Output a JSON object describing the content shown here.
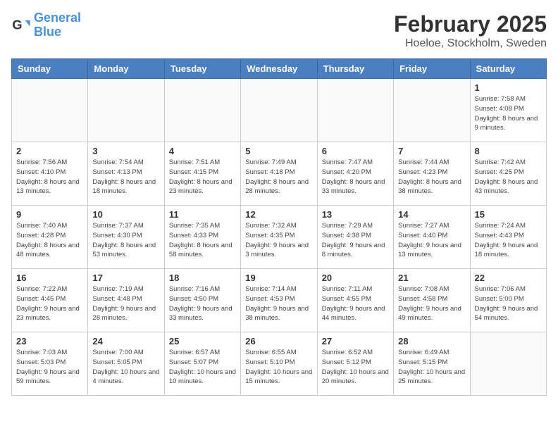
{
  "logo": {
    "line1": "General",
    "line2": "Blue"
  },
  "title": "February 2025",
  "subtitle": "Hoeloe, Stockholm, Sweden",
  "weekdays": [
    "Sunday",
    "Monday",
    "Tuesday",
    "Wednesday",
    "Thursday",
    "Friday",
    "Saturday"
  ],
  "weeks": [
    [
      {
        "day": "",
        "info": ""
      },
      {
        "day": "",
        "info": ""
      },
      {
        "day": "",
        "info": ""
      },
      {
        "day": "",
        "info": ""
      },
      {
        "day": "",
        "info": ""
      },
      {
        "day": "",
        "info": ""
      },
      {
        "day": "1",
        "info": "Sunrise: 7:58 AM\nSunset: 4:08 PM\nDaylight: 8 hours and 9 minutes."
      }
    ],
    [
      {
        "day": "2",
        "info": "Sunrise: 7:56 AM\nSunset: 4:10 PM\nDaylight: 8 hours and 13 minutes."
      },
      {
        "day": "3",
        "info": "Sunrise: 7:54 AM\nSunset: 4:13 PM\nDaylight: 8 hours and 18 minutes."
      },
      {
        "day": "4",
        "info": "Sunrise: 7:51 AM\nSunset: 4:15 PM\nDaylight: 8 hours and 23 minutes."
      },
      {
        "day": "5",
        "info": "Sunrise: 7:49 AM\nSunset: 4:18 PM\nDaylight: 8 hours and 28 minutes."
      },
      {
        "day": "6",
        "info": "Sunrise: 7:47 AM\nSunset: 4:20 PM\nDaylight: 8 hours and 33 minutes."
      },
      {
        "day": "7",
        "info": "Sunrise: 7:44 AM\nSunset: 4:23 PM\nDaylight: 8 hours and 38 minutes."
      },
      {
        "day": "8",
        "info": "Sunrise: 7:42 AM\nSunset: 4:25 PM\nDaylight: 8 hours and 43 minutes."
      }
    ],
    [
      {
        "day": "9",
        "info": "Sunrise: 7:40 AM\nSunset: 4:28 PM\nDaylight: 8 hours and 48 minutes."
      },
      {
        "day": "10",
        "info": "Sunrise: 7:37 AM\nSunset: 4:30 PM\nDaylight: 8 hours and 53 minutes."
      },
      {
        "day": "11",
        "info": "Sunrise: 7:35 AM\nSunset: 4:33 PM\nDaylight: 8 hours and 58 minutes."
      },
      {
        "day": "12",
        "info": "Sunrise: 7:32 AM\nSunset: 4:35 PM\nDaylight: 9 hours and 3 minutes."
      },
      {
        "day": "13",
        "info": "Sunrise: 7:29 AM\nSunset: 4:38 PM\nDaylight: 9 hours and 8 minutes."
      },
      {
        "day": "14",
        "info": "Sunrise: 7:27 AM\nSunset: 4:40 PM\nDaylight: 9 hours and 13 minutes."
      },
      {
        "day": "15",
        "info": "Sunrise: 7:24 AM\nSunset: 4:43 PM\nDaylight: 9 hours and 18 minutes."
      }
    ],
    [
      {
        "day": "16",
        "info": "Sunrise: 7:22 AM\nSunset: 4:45 PM\nDaylight: 9 hours and 23 minutes."
      },
      {
        "day": "17",
        "info": "Sunrise: 7:19 AM\nSunset: 4:48 PM\nDaylight: 9 hours and 28 minutes."
      },
      {
        "day": "18",
        "info": "Sunrise: 7:16 AM\nSunset: 4:50 PM\nDaylight: 9 hours and 33 minutes."
      },
      {
        "day": "19",
        "info": "Sunrise: 7:14 AM\nSunset: 4:53 PM\nDaylight: 9 hours and 38 minutes."
      },
      {
        "day": "20",
        "info": "Sunrise: 7:11 AM\nSunset: 4:55 PM\nDaylight: 9 hours and 44 minutes."
      },
      {
        "day": "21",
        "info": "Sunrise: 7:08 AM\nSunset: 4:58 PM\nDaylight: 9 hours and 49 minutes."
      },
      {
        "day": "22",
        "info": "Sunrise: 7:06 AM\nSunset: 5:00 PM\nDaylight: 9 hours and 54 minutes."
      }
    ],
    [
      {
        "day": "23",
        "info": "Sunrise: 7:03 AM\nSunset: 5:03 PM\nDaylight: 9 hours and 59 minutes."
      },
      {
        "day": "24",
        "info": "Sunrise: 7:00 AM\nSunset: 5:05 PM\nDaylight: 10 hours and 4 minutes."
      },
      {
        "day": "25",
        "info": "Sunrise: 6:57 AM\nSunset: 5:07 PM\nDaylight: 10 hours and 10 minutes."
      },
      {
        "day": "26",
        "info": "Sunrise: 6:55 AM\nSunset: 5:10 PM\nDaylight: 10 hours and 15 minutes."
      },
      {
        "day": "27",
        "info": "Sunrise: 6:52 AM\nSunset: 5:12 PM\nDaylight: 10 hours and 20 minutes."
      },
      {
        "day": "28",
        "info": "Sunrise: 6:49 AM\nSunset: 5:15 PM\nDaylight: 10 hours and 25 minutes."
      },
      {
        "day": "",
        "info": ""
      }
    ]
  ]
}
